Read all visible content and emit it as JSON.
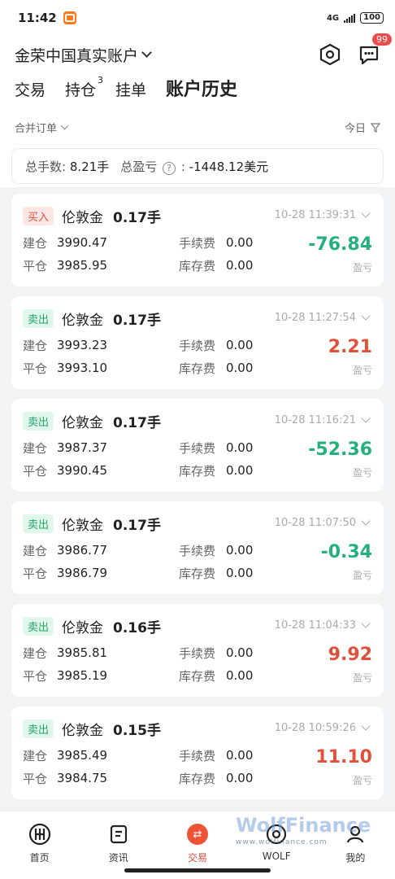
{
  "status": {
    "time": "11:42",
    "network": "4G",
    "battery": "100"
  },
  "header": {
    "account_title": "金荣中国真实账户",
    "message_badge": "99"
  },
  "tabs": [
    {
      "label": "交易"
    },
    {
      "label": "持仓",
      "count": "3"
    },
    {
      "label": "挂单"
    },
    {
      "label": "账户历史",
      "active": true
    }
  ],
  "filter": {
    "left_label": "合并订单",
    "right_label": "今日"
  },
  "summary": {
    "lots_label": "总手数:",
    "lots_value": "8.21手",
    "pnl_label": "总盈亏",
    "pnl_suffix": ":",
    "pnl_value": "-1448.12美元"
  },
  "labels": {
    "open": "建仓",
    "close": "平仓",
    "fee": "手续费",
    "swap": "库存费",
    "pnl": "盈亏"
  },
  "orders": [
    {
      "side": "买入",
      "type": "buy",
      "symbol": "伦敦金",
      "lots": "0.17手",
      "time": "10-28 11:39:31",
      "open": "3990.47",
      "close": "3985.95",
      "fee": "0.00",
      "swap": "0.00",
      "pnl": "-76.84",
      "pnl_sign": "neg"
    },
    {
      "side": "卖出",
      "type": "sell",
      "symbol": "伦敦金",
      "lots": "0.17手",
      "time": "10-28 11:27:54",
      "open": "3993.23",
      "close": "3993.10",
      "fee": "0.00",
      "swap": "0.00",
      "pnl": "2.21",
      "pnl_sign": "pos"
    },
    {
      "side": "卖出",
      "type": "sell",
      "symbol": "伦敦金",
      "lots": "0.17手",
      "time": "10-28 11:16:21",
      "open": "3987.37",
      "close": "3990.45",
      "fee": "0.00",
      "swap": "0.00",
      "pnl": "-52.36",
      "pnl_sign": "neg"
    },
    {
      "side": "卖出",
      "type": "sell",
      "symbol": "伦敦金",
      "lots": "0.17手",
      "time": "10-28 11:07:50",
      "open": "3986.77",
      "close": "3986.79",
      "fee": "0.00",
      "swap": "0.00",
      "pnl": "-0.34",
      "pnl_sign": "neg"
    },
    {
      "side": "卖出",
      "type": "sell",
      "symbol": "伦敦金",
      "lots": "0.16手",
      "time": "10-28 11:04:33",
      "open": "3985.81",
      "close": "3985.19",
      "fee": "0.00",
      "swap": "0.00",
      "pnl": "9.92",
      "pnl_sign": "pos"
    },
    {
      "side": "卖出",
      "type": "sell",
      "symbol": "伦敦金",
      "lots": "0.15手",
      "time": "10-28 10:59:26",
      "open": "3985.49",
      "close": "3984.75",
      "fee": "0.00",
      "swap": "0.00",
      "pnl": "11.10",
      "pnl_sign": "pos"
    }
  ],
  "bottom_nav": [
    {
      "label": "首页",
      "icon": "home-logo-icon"
    },
    {
      "label": "资讯",
      "icon": "news-icon"
    },
    {
      "label": "交易",
      "icon": "trade-icon",
      "active": true
    },
    {
      "label": "WOLF",
      "icon": "wolf-icon"
    },
    {
      "label": "我的",
      "icon": "profile-icon"
    }
  ],
  "watermark": {
    "brand": "WolfFinance",
    "url": "www.wolfinance.com"
  },
  "colors": {
    "buy": "#e0513c",
    "sell": "#23a567",
    "accent": "#ee5337"
  }
}
